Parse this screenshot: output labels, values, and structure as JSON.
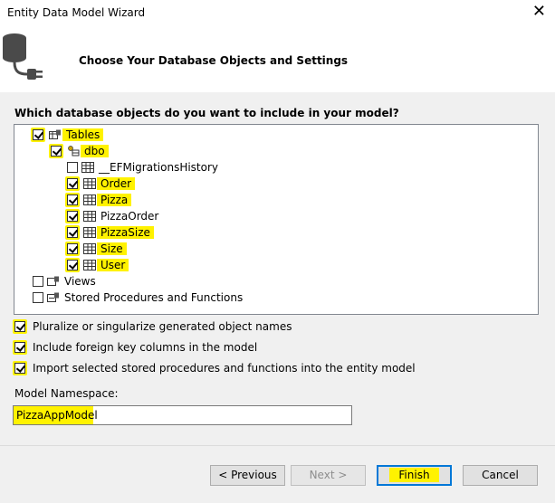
{
  "window": {
    "title": "Entity Data Model Wizard",
    "close_glyph": "✕"
  },
  "header": {
    "title": "Choose Your Database Objects and Settings",
    "icon": "database-plug-icon"
  },
  "question": "Which database objects do you want to include in your model?",
  "tree": {
    "tables": {
      "label": "Tables",
      "checked": true
    },
    "dbo": {
      "label": "dbo",
      "checked": true
    },
    "items": [
      {
        "label": "__EFMigrationsHistory",
        "checked": false
      },
      {
        "label": "Order",
        "checked": true
      },
      {
        "label": "Pizza",
        "checked": true
      },
      {
        "label": "PizzaOrder",
        "checked": true
      },
      {
        "label": "PizzaSize",
        "checked": true
      },
      {
        "label": "Size",
        "checked": true
      },
      {
        "label": "User",
        "checked": true
      }
    ],
    "views": {
      "label": "Views",
      "checked": false
    },
    "stored": {
      "label": "Stored Procedures and Functions",
      "checked": false
    }
  },
  "options": {
    "pluralize": {
      "label": "Pluralize or singularize generated object names",
      "checked": true
    },
    "foreign_keys": {
      "label": "Include foreign key columns in the model",
      "checked": true
    },
    "import_sp": {
      "label": "Import selected stored procedures and functions into the entity model",
      "checked": true
    }
  },
  "namespace": {
    "label": "Model Namespace:",
    "value": "PizzaAppModel"
  },
  "buttons": {
    "previous": "< Previous",
    "next": "Next >",
    "finish": "Finish",
    "cancel": "Cancel"
  },
  "colors": {
    "highlight": "#fff200",
    "accent": "#0078d7"
  }
}
